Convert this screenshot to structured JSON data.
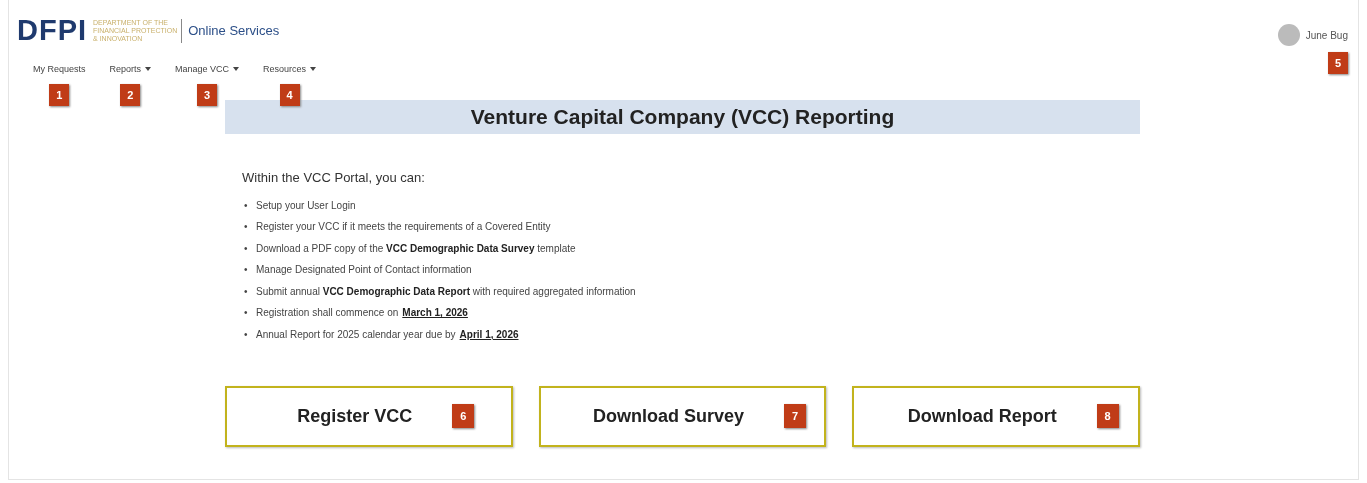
{
  "header": {
    "logo": "DFPI",
    "logo_subtitle": [
      "DEPARTMENT OF THE",
      "FINANCIAL PROTECTION",
      "& INNOVATION"
    ],
    "site_name": "Online Services",
    "user": {
      "name": "June Bug",
      "marker": "5"
    }
  },
  "nav": [
    {
      "label": "My Requests",
      "dropdown": false,
      "marker": "1"
    },
    {
      "label": "Reports",
      "dropdown": true,
      "marker": "2"
    },
    {
      "label": "Manage VCC",
      "dropdown": true,
      "marker": "3"
    },
    {
      "label": "Resources",
      "dropdown": true,
      "marker": "4"
    }
  ],
  "banner": {
    "title": "Venture Capital Company (VCC) Reporting"
  },
  "intro": "Within the VCC Portal, you can:",
  "bullets": [
    {
      "bullet": "•",
      "text": "Setup your User Login"
    },
    {
      "bullet": "•",
      "text": "Register your VCC if it meets the requirements of a Covered Entity"
    },
    {
      "bullet": "•",
      "text": "Download a PDF copy of the **VCC Demographic Data Survey** template"
    },
    {
      "bullet": "•",
      "text": "Manage Designated Point of Contact information"
    },
    {
      "bullet": "•",
      "text": "Submit annual **VCC Demographic Data Report** with required aggregated information"
    },
    {
      "bullet": "•",
      "text": "Registration shall commence on",
      "link": "March 1, 2026"
    },
    {
      "bullet": "•",
      "text": "Annual Report for 2025 calendar year due by",
      "link": "April 1, 2026"
    }
  ],
  "buttons": [
    {
      "label": "Register VCC",
      "marker": "6"
    },
    {
      "label": "Download Survey",
      "marker": "7"
    },
    {
      "label": "Download Report",
      "marker": "8"
    }
  ]
}
